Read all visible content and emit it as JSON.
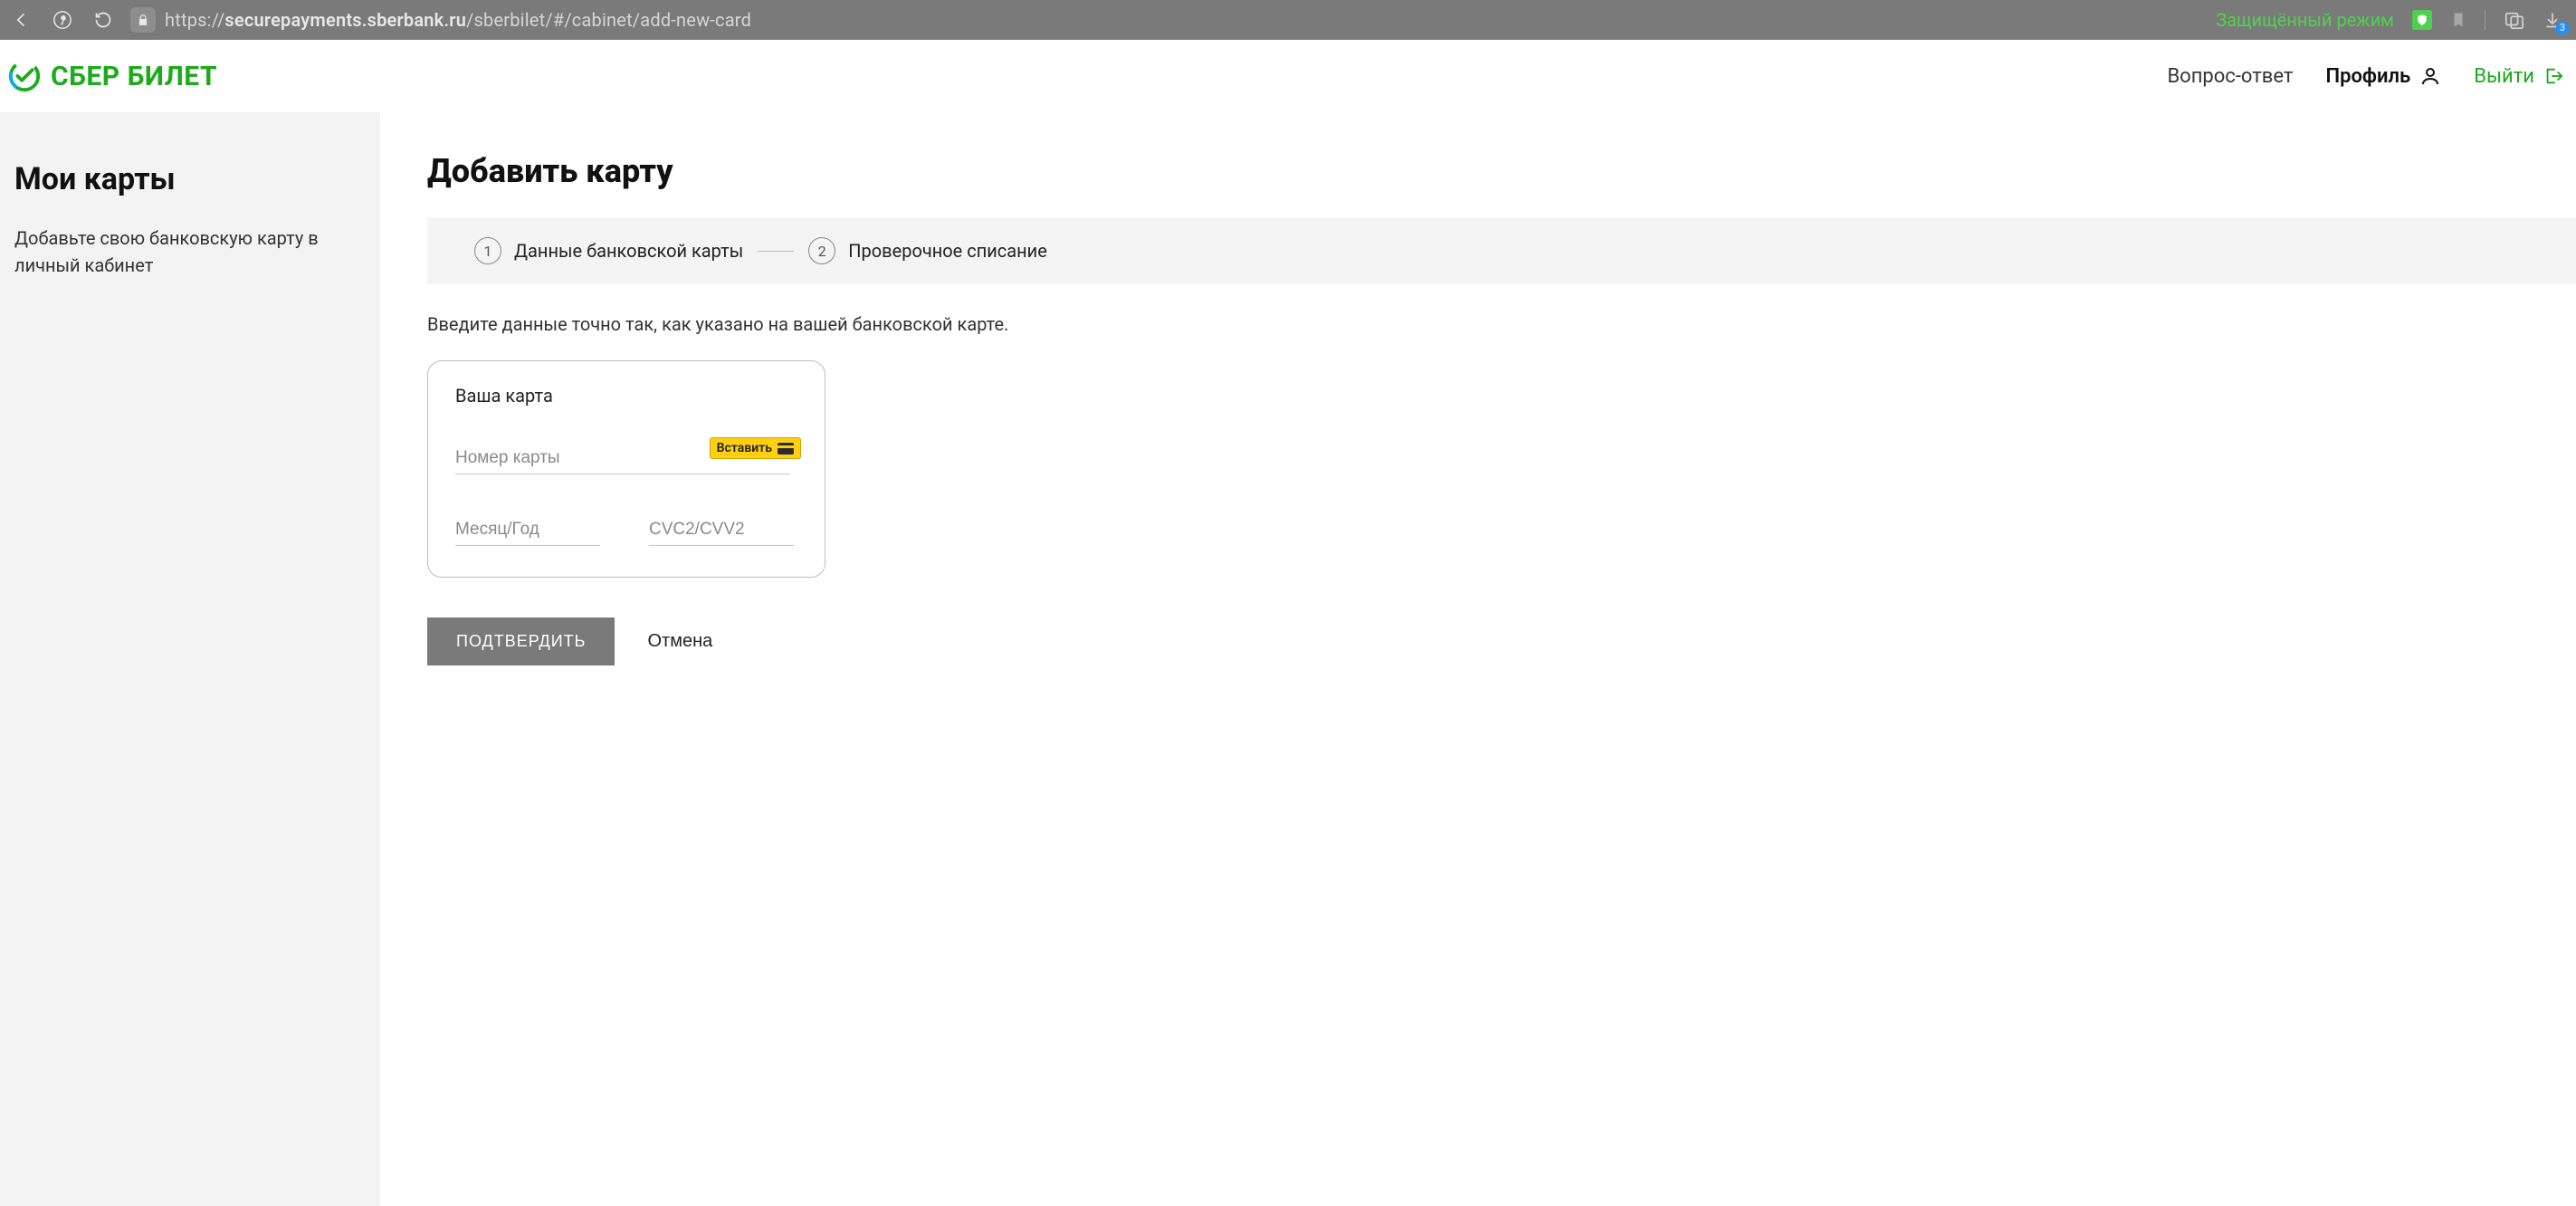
{
  "browser": {
    "url_host": "securepayments.sberbank.ru",
    "url_prefix": "https://",
    "url_path": "/sberbilet/#/cabinet/add-new-card",
    "secure_mode": "Защищённый режим",
    "download_count": "3"
  },
  "header": {
    "brand": "СБЕР БИЛЕТ",
    "faq": "Вопрос-ответ",
    "profile": "Профиль",
    "logout": "Выйти"
  },
  "sidebar": {
    "title": "Мои карты",
    "subtitle": "Добавьте свою банковскую карту в личный кабинет"
  },
  "main": {
    "title": "Добавить карту",
    "steps": {
      "s1_num": "1",
      "s1_label": "Данные банковской карты",
      "s2_num": "2",
      "s2_label": "Проверочное списание"
    },
    "hint": "Введите данные точно так, как указано на вашей банковской карте.",
    "card": {
      "title": "Ваша карта",
      "number_placeholder": "Номер карты",
      "paste_label": "Вставить",
      "exp_placeholder": "Месяц/Год",
      "cvc_placeholder": "CVC2/CVV2"
    },
    "actions": {
      "submit": "ПОДТВЕРДИТЬ",
      "cancel": "Отмена"
    }
  }
}
